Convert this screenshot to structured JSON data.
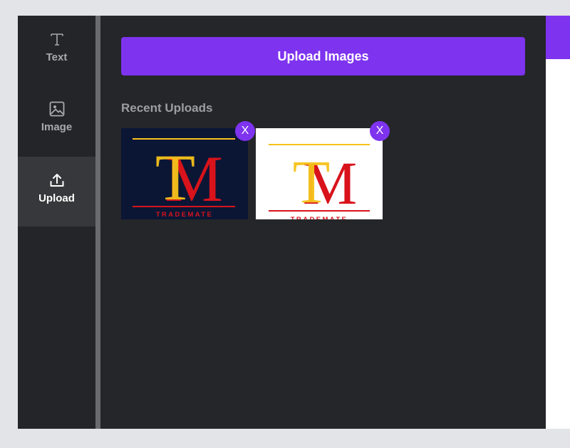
{
  "sidebar": {
    "items": [
      {
        "label": "Text",
        "icon": "text-icon",
        "active": false
      },
      {
        "label": "Image",
        "icon": "image-icon",
        "active": false
      },
      {
        "label": "Upload",
        "icon": "upload-icon",
        "active": true
      }
    ]
  },
  "panel": {
    "upload_button_label": "Upload Images",
    "recent_title": "Recent Uploads",
    "uploads": [
      {
        "name": "trademate-logo-dark",
        "logo_letters": "TM",
        "logo_text": "TRADEMATE",
        "background": "#0b1635",
        "remove_label": "X"
      },
      {
        "name": "trademate-logo-white",
        "logo_letters": "TM",
        "logo_text": "TRADEMATE",
        "background": "#ffffff",
        "remove_label": "X"
      }
    ]
  },
  "colors": {
    "accent": "#7e33ef",
    "rail_bg": "#242528",
    "panel_bg": "#252629",
    "logo_red": "#d8131b",
    "logo_yellow": "#f6c21b"
  }
}
